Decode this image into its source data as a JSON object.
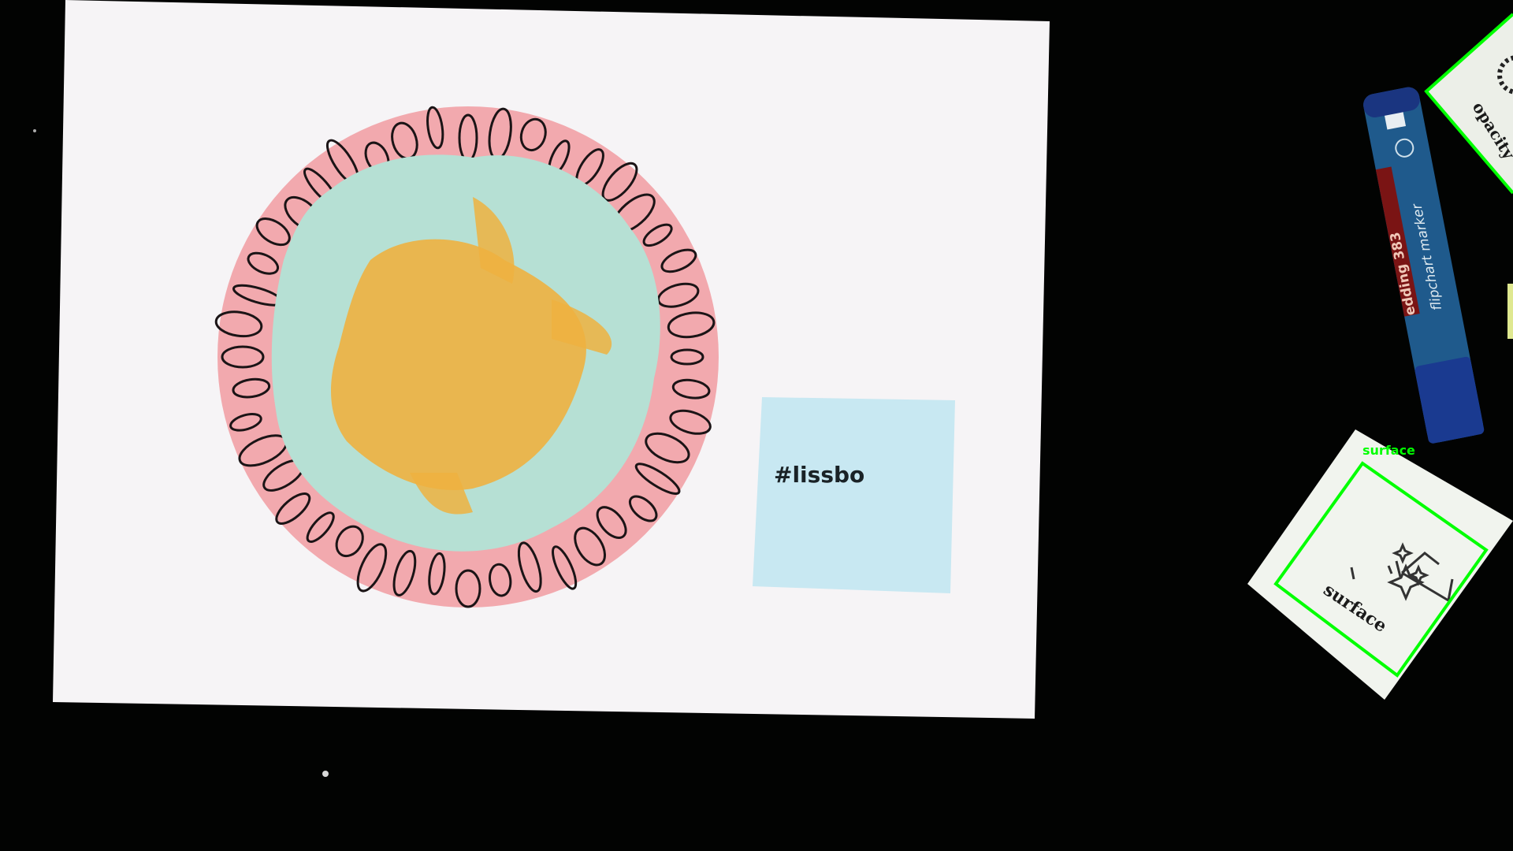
{
  "scene": {
    "sticky_note_text": "#lissbo",
    "marker": {
      "brand": "edding 383",
      "label": "flipchart marker"
    },
    "cards": [
      {
        "printed_text": "surface"
      },
      {
        "printed_text": "opacity"
      }
    ]
  },
  "detections": [
    {
      "label": "surface",
      "color": "#00ff00"
    },
    {
      "label": "",
      "color": "#00ff00"
    }
  ],
  "colors": {
    "background": "#020302",
    "paper": "#f6f4f6",
    "pink_disc": "#f2a9ae",
    "blob_mint": "#b6e0d4",
    "blob_orange": "#eeb140",
    "sticky_note": "#c8e8f2",
    "marker_blue": "#1f5a8c",
    "detection_box": "#00ff00"
  }
}
